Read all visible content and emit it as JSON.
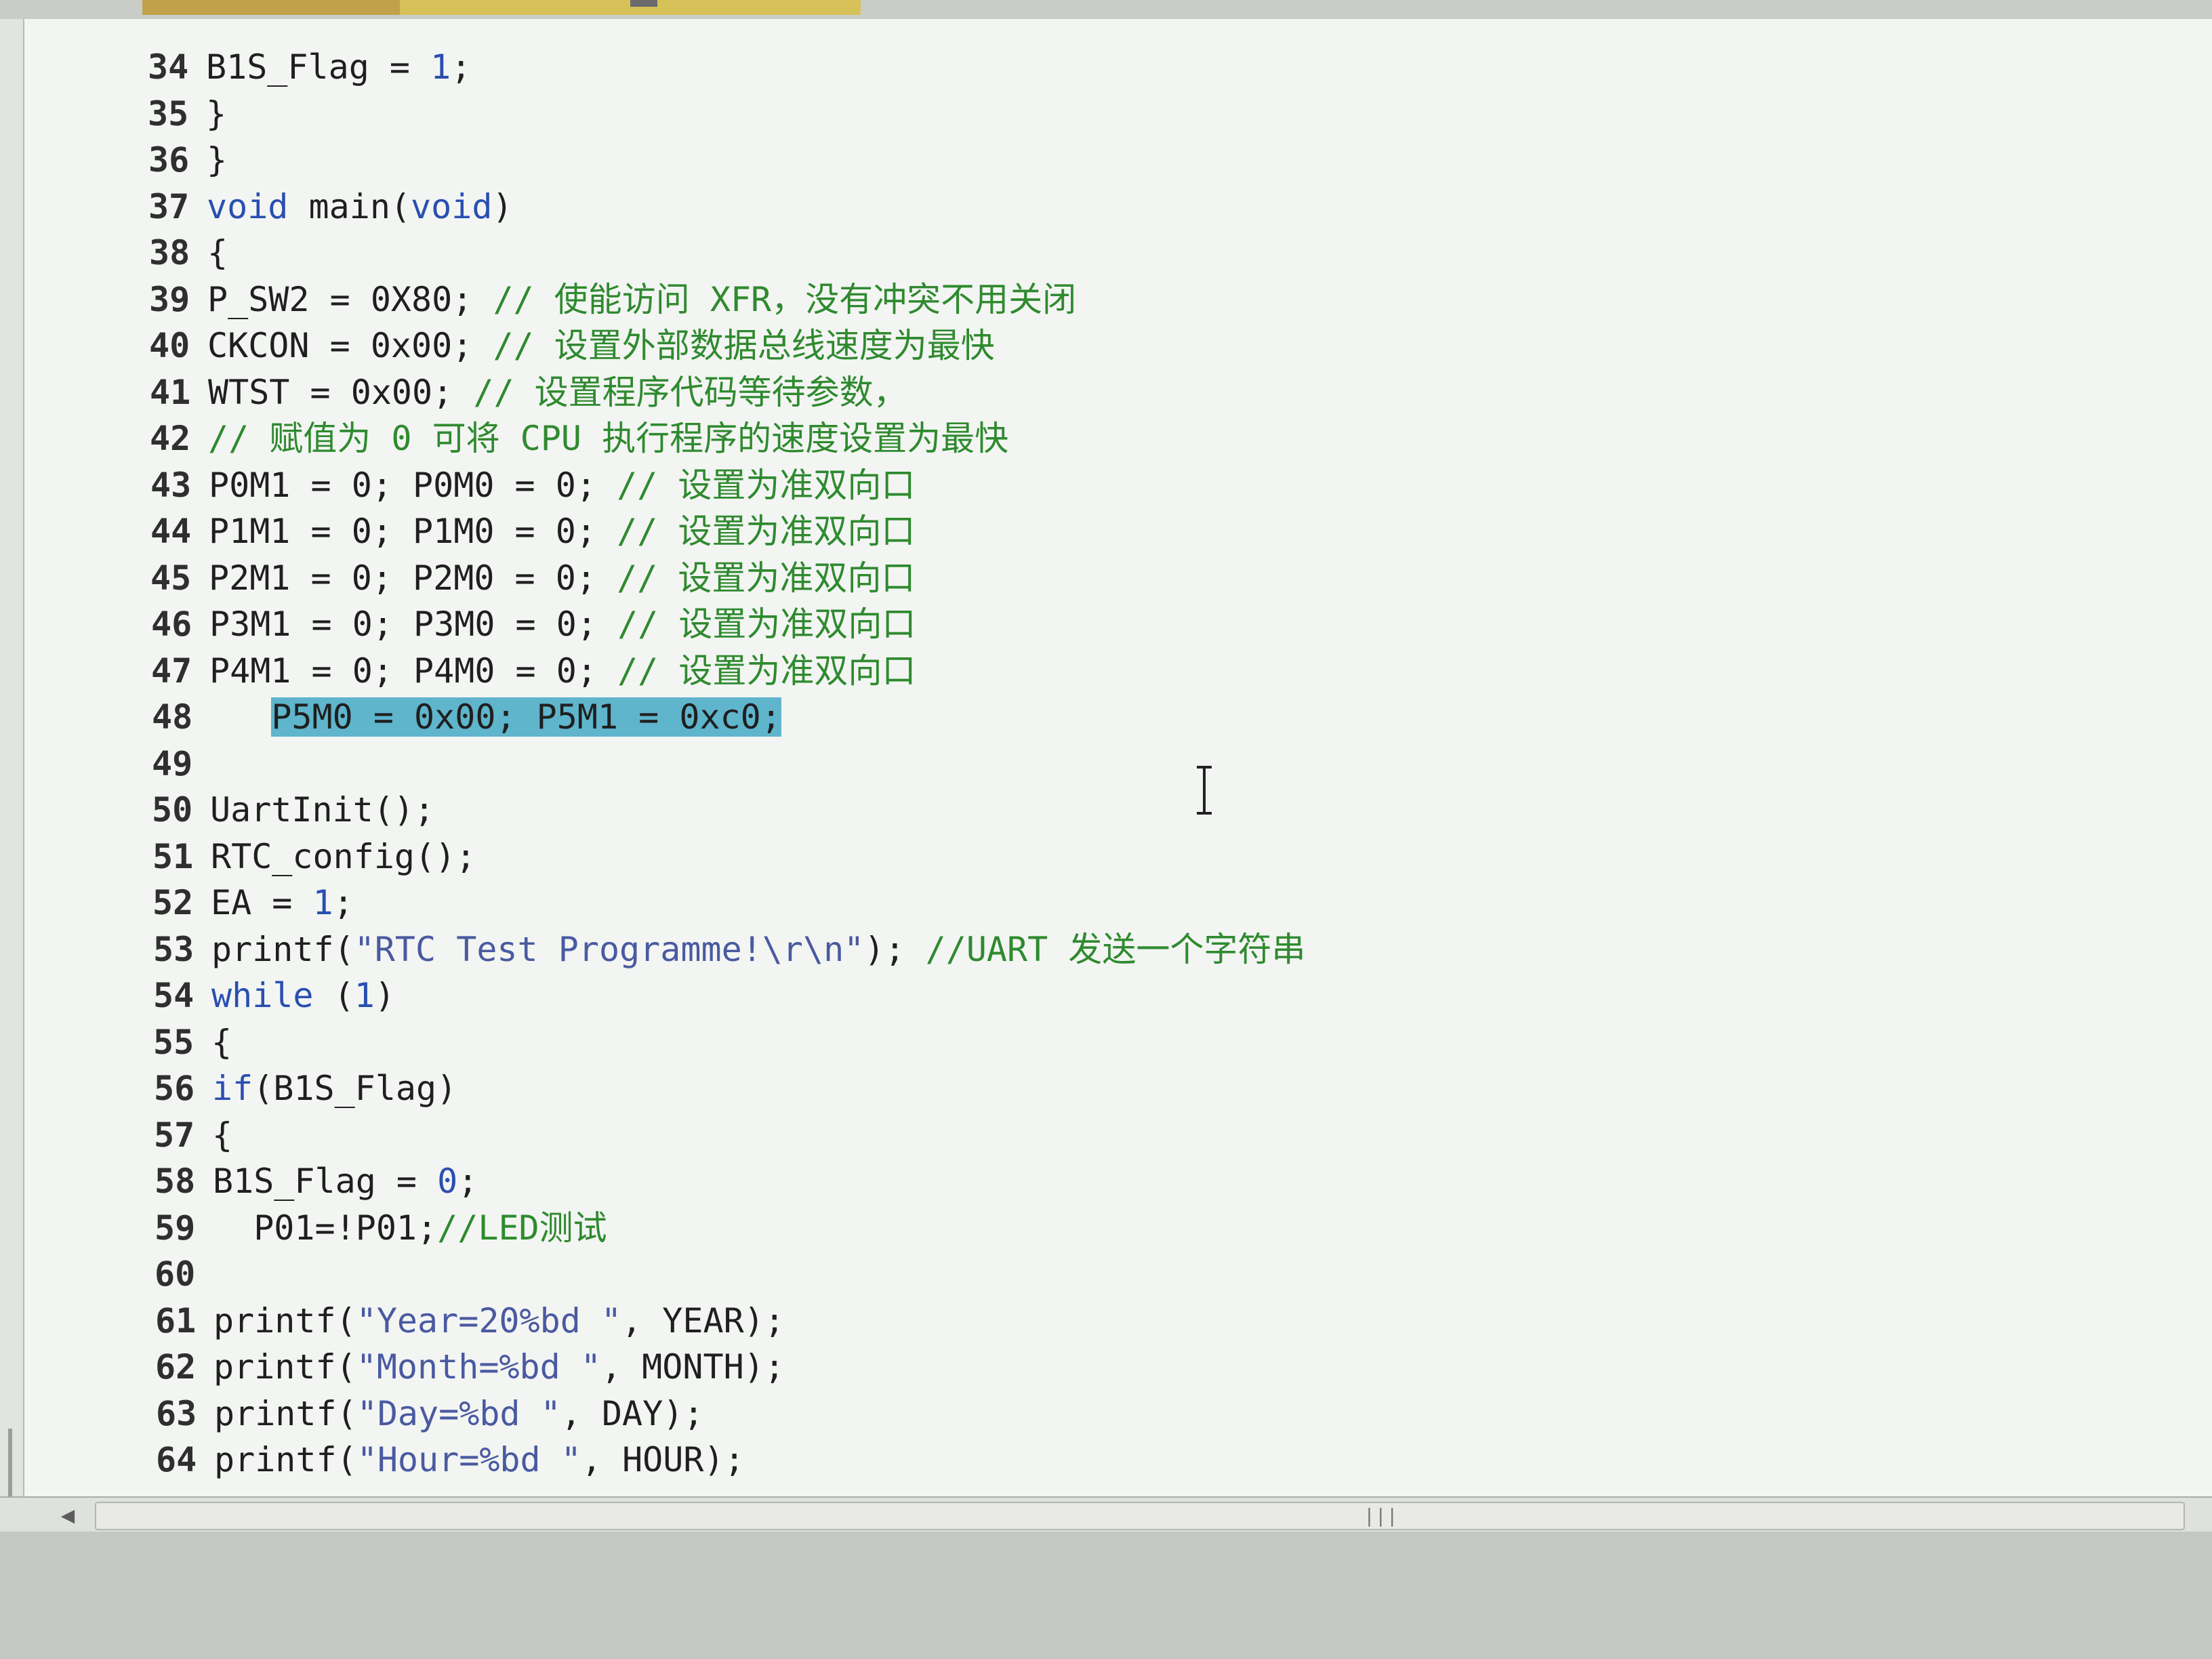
{
  "editor": {
    "lines": [
      {
        "n": "34",
        "code": [
          {
            "t": "B1S_Flag = ",
            "c": ""
          },
          {
            "t": "1",
            "c": "num"
          },
          {
            "t": ";",
            "c": ""
          }
        ]
      },
      {
        "n": "35",
        "code": [
          {
            "t": "}",
            "c": ""
          }
        ]
      },
      {
        "n": "36",
        "code": [
          {
            "t": "}",
            "c": ""
          }
        ]
      },
      {
        "n": "37",
        "code": [
          {
            "t": "void",
            "c": "kw"
          },
          {
            "t": " main(",
            "c": ""
          },
          {
            "t": "void",
            "c": "kw"
          },
          {
            "t": ")",
            "c": ""
          }
        ]
      },
      {
        "n": "38",
        "code": [
          {
            "t": "{",
            "c": ""
          }
        ]
      },
      {
        "n": "39",
        "code": [
          {
            "t": "P_SW2 = 0X80; ",
            "c": ""
          },
          {
            "t": "// 使能访问 XFR，没有冲突不用关闭",
            "c": "cm"
          }
        ]
      },
      {
        "n": "40",
        "code": [
          {
            "t": "CKCON = 0x00; ",
            "c": ""
          },
          {
            "t": "// 设置外部数据总线速度为最快",
            "c": "cm"
          }
        ]
      },
      {
        "n": "41",
        "code": [
          {
            "t": "WTST = 0x00; ",
            "c": ""
          },
          {
            "t": "// 设置程序代码等待参数，",
            "c": "cm"
          }
        ]
      },
      {
        "n": "42",
        "code": [
          {
            "t": "// 赋值为 0 可将 CPU 执行程序的速度设置为最快",
            "c": "cm"
          }
        ]
      },
      {
        "n": "43",
        "code": [
          {
            "t": "P0M1 = 0; P0M0 = 0; ",
            "c": ""
          },
          {
            "t": "// 设置为准双向口",
            "c": "cm"
          }
        ]
      },
      {
        "n": "44",
        "code": [
          {
            "t": "P1M1 = 0; P1M0 = 0; ",
            "c": ""
          },
          {
            "t": "// 设置为准双向口",
            "c": "cm"
          }
        ]
      },
      {
        "n": "45",
        "code": [
          {
            "t": "P2M1 = 0; P2M0 = 0; ",
            "c": ""
          },
          {
            "t": "// 设置为准双向口",
            "c": "cm"
          }
        ]
      },
      {
        "n": "46",
        "code": [
          {
            "t": "P3M1 = 0; P3M0 = 0; ",
            "c": ""
          },
          {
            "t": "// 设置为准双向口",
            "c": "cm"
          }
        ]
      },
      {
        "n": "47",
        "code": [
          {
            "t": "P4M1 = 0; P4M0 = 0; ",
            "c": ""
          },
          {
            "t": "// 设置为准双向口",
            "c": "cm"
          }
        ]
      },
      {
        "n": "48",
        "code": [
          {
            "t": "   ",
            "c": ""
          },
          {
            "t": "P5M0 = 0x00; P5M1 = 0xc0;",
            "c": "sel"
          }
        ]
      },
      {
        "n": "49",
        "code": []
      },
      {
        "n": "50",
        "code": [
          {
            "t": "UartInit();",
            "c": ""
          }
        ]
      },
      {
        "n": "51",
        "code": [
          {
            "t": "RTC_config();",
            "c": ""
          }
        ]
      },
      {
        "n": "52",
        "code": [
          {
            "t": "EA = ",
            "c": ""
          },
          {
            "t": "1",
            "c": "num"
          },
          {
            "t": ";",
            "c": ""
          }
        ]
      },
      {
        "n": "53",
        "code": [
          {
            "t": "printf(",
            "c": ""
          },
          {
            "t": "\"RTC Test Programme!\\r\\n\"",
            "c": "st"
          },
          {
            "t": "); ",
            "c": ""
          },
          {
            "t": "//UART 发送一个字符串",
            "c": "cm"
          }
        ]
      },
      {
        "n": "54",
        "code": [
          {
            "t": "while",
            "c": "kw"
          },
          {
            "t": " (",
            "c": ""
          },
          {
            "t": "1",
            "c": "num"
          },
          {
            "t": ")",
            "c": ""
          }
        ]
      },
      {
        "n": "55",
        "code": [
          {
            "t": "{",
            "c": ""
          }
        ]
      },
      {
        "n": "56",
        "code": [
          {
            "t": "if",
            "c": "kw"
          },
          {
            "t": "(B1S_Flag)",
            "c": ""
          }
        ]
      },
      {
        "n": "57",
        "code": [
          {
            "t": "{",
            "c": ""
          }
        ]
      },
      {
        "n": "58",
        "code": [
          {
            "t": "B1S_Flag = ",
            "c": ""
          },
          {
            "t": "0",
            "c": "num"
          },
          {
            "t": ";",
            "c": ""
          }
        ]
      },
      {
        "n": "59",
        "code": [
          {
            "t": "  P01=!P01;",
            "c": ""
          },
          {
            "t": "//LED测试",
            "c": "cm"
          }
        ]
      },
      {
        "n": "60",
        "code": []
      },
      {
        "n": "61",
        "code": [
          {
            "t": "printf(",
            "c": ""
          },
          {
            "t": "\"Year=20%bd \"",
            "c": "st"
          },
          {
            "t": ", YEAR);",
            "c": ""
          }
        ]
      },
      {
        "n": "62",
        "code": [
          {
            "t": "printf(",
            "c": ""
          },
          {
            "t": "\"Month=%bd \"",
            "c": "st"
          },
          {
            "t": ", MONTH);",
            "c": ""
          }
        ]
      },
      {
        "n": "63",
        "code": [
          {
            "t": "printf(",
            "c": ""
          },
          {
            "t": "\"Day=%bd \"",
            "c": "st"
          },
          {
            "t": ", DAY);",
            "c": ""
          }
        ]
      },
      {
        "n": "64",
        "code": [
          {
            "t": "printf(",
            "c": ""
          },
          {
            "t": "\"Hour=%bd \"",
            "c": "st"
          },
          {
            "t": ", HOUR);",
            "c": ""
          }
        ]
      }
    ]
  },
  "scrollbar": {
    "left_arrow": "◀",
    "grip": "|||"
  },
  "colors": {
    "keyword": "#2a4fb0",
    "comment": "#2f8a2f",
    "string": "#4a5aa0",
    "selection": "#5fb5cc"
  },
  "icons": {
    "cursor": "i-beam-icon",
    "scroll_left": "arrow-left-icon"
  }
}
